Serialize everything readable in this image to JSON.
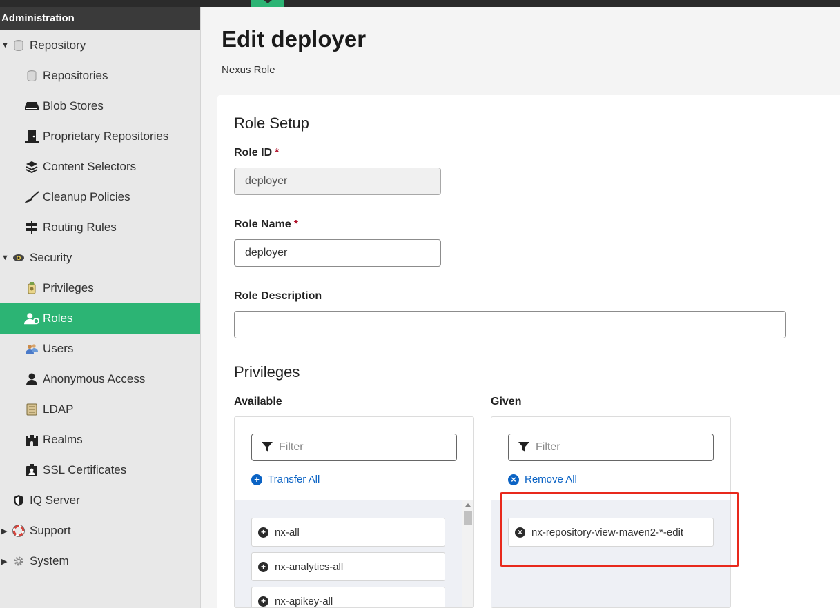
{
  "sidebar": {
    "header": "Administration",
    "items": [
      {
        "label": "Repository",
        "icon": "database-icon",
        "level": 0,
        "caret": "down"
      },
      {
        "label": "Repositories",
        "icon": "database-icon",
        "level": 1
      },
      {
        "label": "Blob Stores",
        "icon": "hard-drive-icon",
        "level": 1
      },
      {
        "label": "Proprietary Repositories",
        "icon": "door-icon",
        "level": 1
      },
      {
        "label": "Content Selectors",
        "icon": "layers-icon",
        "level": 1
      },
      {
        "label": "Cleanup Policies",
        "icon": "broom-icon",
        "level": 1
      },
      {
        "label": "Routing Rules",
        "icon": "signpost-icon",
        "level": 1
      },
      {
        "label": "Security",
        "icon": "eye-icon",
        "level": 0,
        "caret": "down"
      },
      {
        "label": "Privileges",
        "icon": "badge-icon",
        "level": 1
      },
      {
        "label": "Roles",
        "icon": "users-cog-icon",
        "level": 1,
        "active": true
      },
      {
        "label": "Users",
        "icon": "users-icon",
        "level": 1
      },
      {
        "label": "Anonymous Access",
        "icon": "user-icon",
        "level": 1
      },
      {
        "label": "LDAP",
        "icon": "book-icon",
        "level": 1
      },
      {
        "label": "Realms",
        "icon": "castle-icon",
        "level": 1
      },
      {
        "label": "SSL Certificates",
        "icon": "id-card-icon",
        "level": 1
      },
      {
        "label": "IQ Server",
        "icon": "shield-icon",
        "level": 0
      },
      {
        "label": "Support",
        "icon": "lifebuoy-icon",
        "level": 0,
        "caret": "right"
      },
      {
        "label": "System",
        "icon": "gear-icon",
        "level": 0,
        "caret": "right"
      }
    ]
  },
  "page": {
    "title": "Edit deployer",
    "subtitle": "Nexus Role"
  },
  "form": {
    "section_title": "Role Setup",
    "role_id_label": "Role ID",
    "role_id_value": "deployer",
    "role_name_label": "Role Name",
    "role_name_value": "deployer",
    "role_description_label": "Role Description",
    "role_description_value": "",
    "required_mark": "*"
  },
  "privileges": {
    "section_title": "Privileges",
    "available": {
      "label": "Available",
      "filter_placeholder": "Filter",
      "action_label": "Transfer All",
      "items": [
        "nx-all",
        "nx-analytics-all",
        "nx-apikey-all"
      ]
    },
    "given": {
      "label": "Given",
      "filter_placeholder": "Filter",
      "action_label": "Remove All",
      "items": [
        "nx-repository-view-maven2-*-edit"
      ]
    }
  },
  "colors": {
    "accent": "#2cb474",
    "sidebar_header": "#3a3a3a",
    "link": "#0b63c4",
    "required": "#b0122a",
    "highlight": "#e8291c"
  }
}
